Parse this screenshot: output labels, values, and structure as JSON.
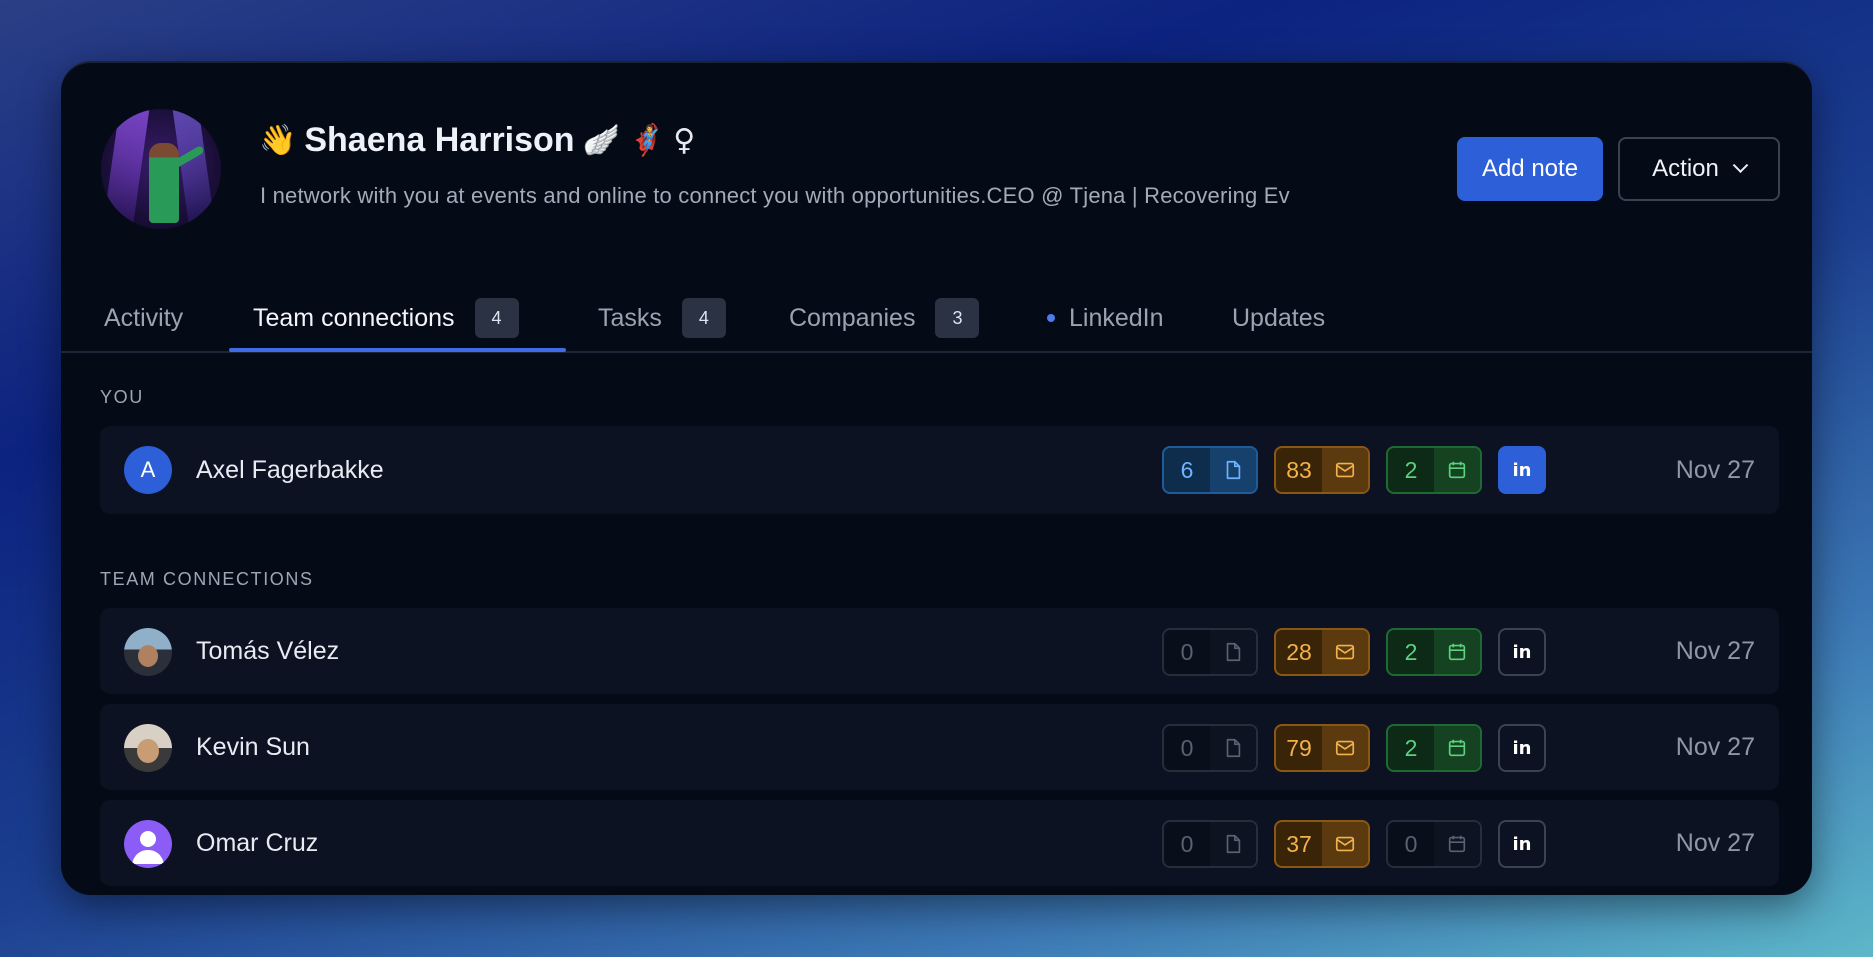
{
  "profile": {
    "name": "Shaena Harrison",
    "emoji_prefix": "👋",
    "emoji_suffix": [
      "🪽",
      "🦸‍♀️",
      "♀"
    ],
    "bio": "I network with you at events and online to connect you with opportunities.CEO @ Tjena | Recovering Ev"
  },
  "actions": {
    "add_note": "Add note",
    "action": "Action"
  },
  "tabs": [
    {
      "label": "Activity",
      "badge": null
    },
    {
      "label": "Team connections",
      "badge": "4"
    },
    {
      "label": "Tasks",
      "badge": "4"
    },
    {
      "label": "Companies",
      "badge": "3"
    },
    {
      "label": "LinkedIn",
      "badge": null
    },
    {
      "label": "Updates",
      "badge": null
    }
  ],
  "sections": {
    "you": "YOU",
    "team": "TEAM CONNECTIONS"
  },
  "rows": [
    {
      "initial": "A",
      "name": "Axel Fagerbakke",
      "notes": "6",
      "emails": "83",
      "meetings": "2",
      "date": "Nov 27"
    },
    {
      "name": "Tomás Vélez",
      "notes": "0",
      "emails": "28",
      "meetings": "2",
      "date": "Nov 27"
    },
    {
      "name": "Kevin Sun",
      "notes": "0",
      "emails": "79",
      "meetings": "2",
      "date": "Nov 27"
    },
    {
      "name": "Omar Cruz",
      "notes": "0",
      "emails": "37",
      "meetings": "0",
      "date": "Nov 27"
    }
  ],
  "linkedin_glyph": "in",
  "icons": [
    "note-icon",
    "mail-icon",
    "calendar-icon",
    "linkedin-icon",
    "chevron-down-icon"
  ],
  "colors": {
    "accent": "#2d5fd8",
    "notes": "#6fb3ff",
    "emails": "#f3b24a",
    "meetings": "#5bd27d"
  }
}
